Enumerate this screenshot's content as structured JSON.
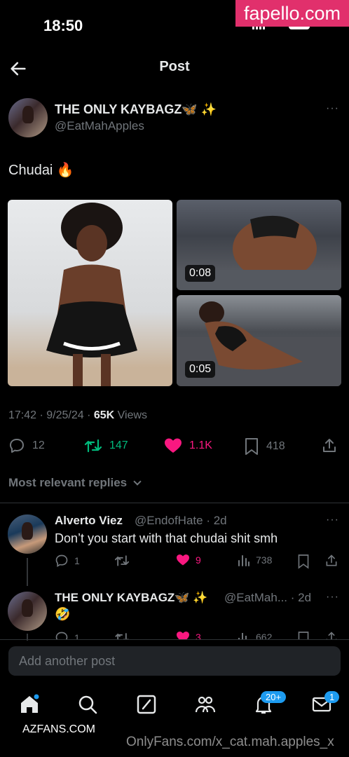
{
  "status": {
    "time": "18:50"
  },
  "watermarks": {
    "top": "fapello.com",
    "left": "AZFANS.COM",
    "bottom": "OnlyFans.com/x_cat.mah.apples_x"
  },
  "nav": {
    "title": "Post"
  },
  "post": {
    "author_name": "THE ONLY KAYBAGZ🦋 ✨",
    "author_handle": "@EatMahApples",
    "text": "Chudai 🔥",
    "media": [
      {
        "type": "photo"
      },
      {
        "type": "video",
        "duration": "0:08"
      },
      {
        "type": "video",
        "duration": "0:05"
      }
    ],
    "timestamp": "17:42 · 9/25/24 · ",
    "views_count": "65K",
    "views_label": " Views",
    "stats": {
      "replies": "12",
      "reposts": "147",
      "likes": "1.1K",
      "bookmarks": "418"
    }
  },
  "replies_filter": {
    "label": "Most relevant replies"
  },
  "replies": [
    {
      "name": "Alverto Viez",
      "handle": "@EndofHate · 2d",
      "text": "Don’t you start with that chudai shit smh",
      "stats": {
        "replies": "1",
        "reposts": "",
        "likes": "9",
        "views": "738"
      }
    },
    {
      "name": "THE ONLY KAYBAGZ🦋 ✨",
      "handle": "@EatMah... · 2d",
      "text": "🤣",
      "stats": {
        "replies": "1",
        "reposts": "",
        "likes": "3",
        "views": "662"
      }
    }
  ],
  "compose": {
    "placeholder": "Add another post"
  },
  "tabbar": {
    "notifications_badge": "20+",
    "messages_badge": "1"
  },
  "colors": {
    "accent": "#1d9bf0",
    "like": "#f91880",
    "repost": "#00ba7c",
    "muted": "#71767b"
  }
}
